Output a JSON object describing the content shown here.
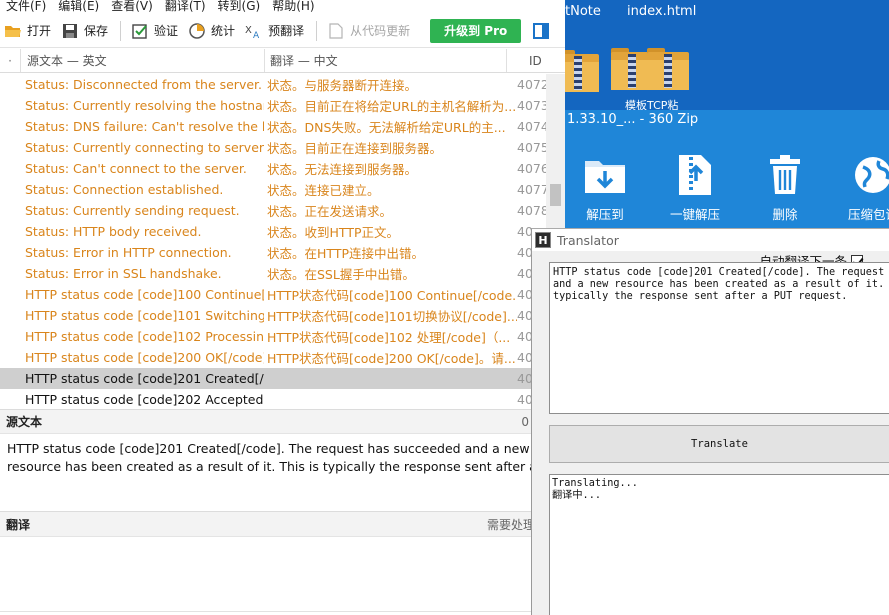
{
  "menu": [
    "文件(F)",
    "编辑(E)",
    "查看(V)",
    "翻译(T)",
    "转到(G)",
    "帮助(H)"
  ],
  "toolbar": {
    "open": "打开",
    "save": "保存",
    "validate": "验证",
    "stats": "统计",
    "pretranslate": "预翻译",
    "update_from_code": "从代码更新",
    "upgrade_pro": "升级到 Pro"
  },
  "list_header": {
    "dot": "·",
    "source": "源文本 — 英文",
    "translation": "翻译 — 中文",
    "id": "ID"
  },
  "rows": [
    {
      "source": "Status: Disconnected from the server.",
      "translation": "状态。与服务器断开连接。",
      "id": "4072"
    },
    {
      "source": "Status: Currently resolving the hostnam...",
      "translation": "状态。目前正在将给定URL的主机名解析为...",
      "id": "4073"
    },
    {
      "source": "Status: DNS failure: Can't resolve the h...",
      "translation": "状态。DNS失败。无法解析给定URL的主...",
      "id": "4074"
    },
    {
      "source": "Status: Currently connecting to server.",
      "translation": "状态。目前正在连接到服务器。",
      "id": "4075"
    },
    {
      "source": "Status: Can't connect to the server.",
      "translation": "状态。无法连接到服务器。",
      "id": "4076"
    },
    {
      "source": "Status: Connection established.",
      "translation": "状态。连接已建立。",
      "id": "4077"
    },
    {
      "source": "Status: Currently sending request.",
      "translation": "状态。正在发送请求。",
      "id": "4078"
    },
    {
      "source": "Status: HTTP body received.",
      "translation": "状态。收到HTTP正文。",
      "id": "40"
    },
    {
      "source": "Status: Error in HTTP connection.",
      "translation": "状态。在HTTP连接中出错。",
      "id": "40"
    },
    {
      "source": "Status: Error in SSL handshake.",
      "translation": "状态。在SSL握手中出错。",
      "id": "40"
    },
    {
      "source": "HTTP status code [code]100 Continue[/...",
      "translation": "HTTP状态代码[code]100 Continue[/code...",
      "id": "40"
    },
    {
      "source": "HTTP status code [code]101 Switching ...",
      "translation": "HTTP状态代码[code]101切换协议[/code]...",
      "id": "40"
    },
    {
      "source": "HTTP status code [code]102 Processin...",
      "translation": "HTTP状态代码[code]102 处理[/code]（...",
      "id": "40"
    },
    {
      "source": "HTTP status code [code]200 OK[/code]...",
      "translation": "HTTP状态代码[code]200 OK[/code]。请...",
      "id": "40"
    },
    {
      "source": "HTTP status code [code]201 Created[/...",
      "translation": "",
      "id": "40"
    },
    {
      "source": "HTTP status code [code]202 Accepted[...",
      "translation": "",
      "id": "40"
    }
  ],
  "source_panel": {
    "title": "源文本",
    "count": "0",
    "text": "HTTP status code [code]201 Created[/code]. The request has succeeded and a new resource has been created as a result of it. This is typically the response sent after a PUT request."
  },
  "translation_panel": {
    "title": "翻译",
    "needs_work": "需要处理"
  },
  "desktop": {
    "label1": "tNote",
    "label2": "index.html",
    "label3": "模板TCP粘",
    "zip_title": "1.33.10_... - 360 Zip",
    "zip_buttons": [
      "解压到",
      "一键解压",
      "删除",
      "压缩包语"
    ]
  },
  "translator": {
    "title": "Translator",
    "auto_next": "自动翻译下一条",
    "source_text": "HTTP status code [code]201 Created[/code]. The request has succeeded\nand a new resource has been created as a result of it. This is\ntypically the response sent after a PUT request.",
    "button": "Translate",
    "output": "Translating...\n翻译中..."
  }
}
